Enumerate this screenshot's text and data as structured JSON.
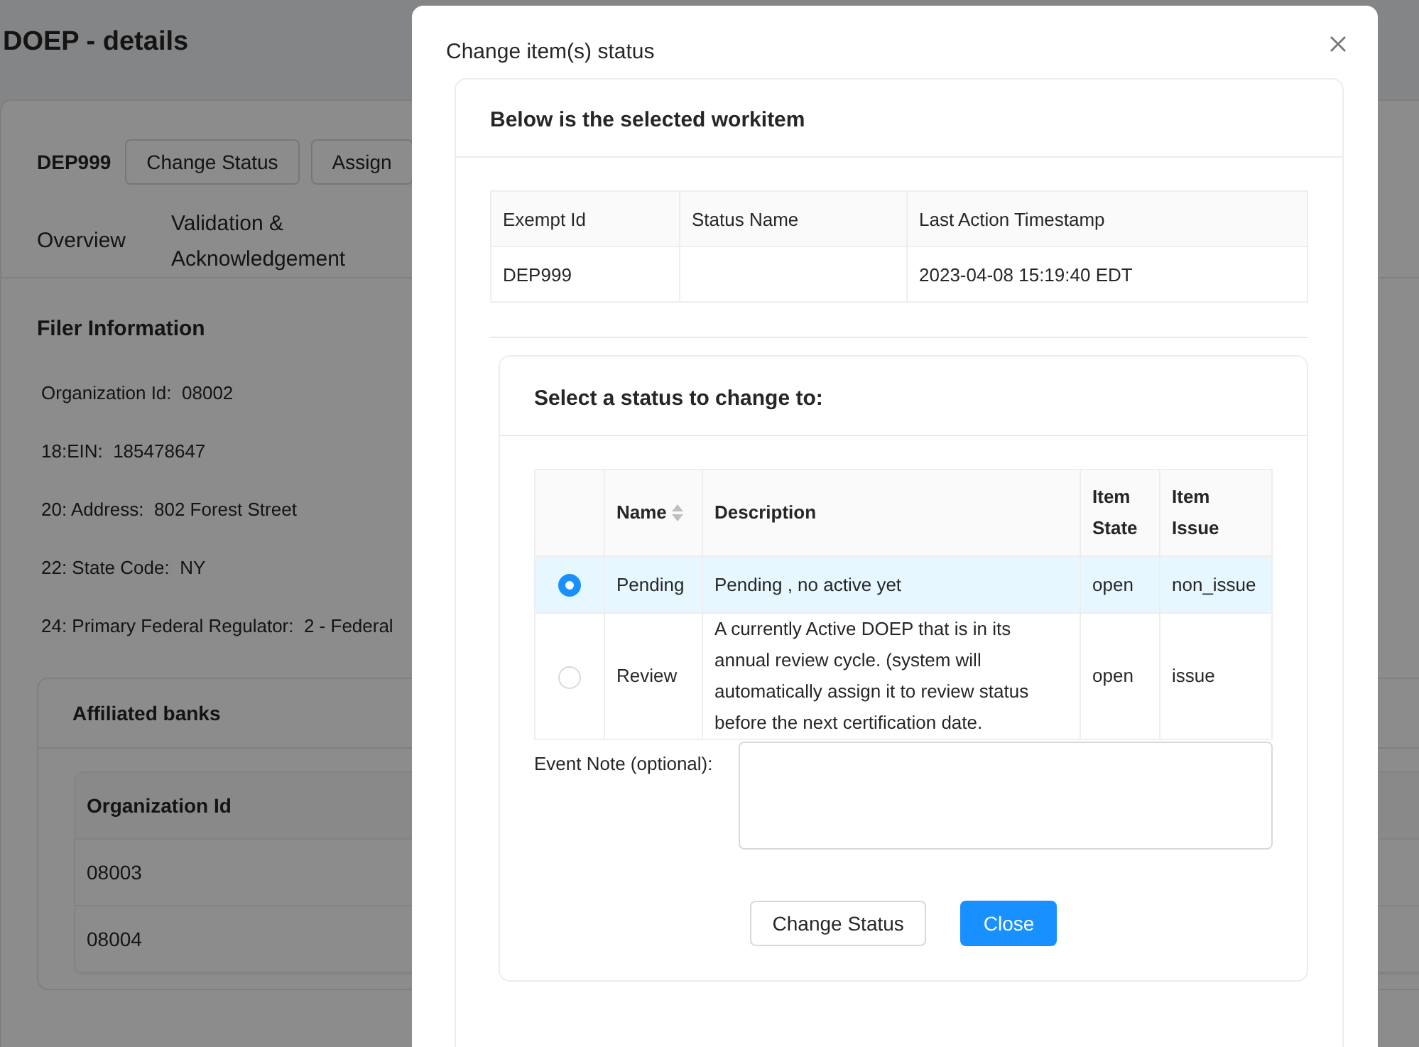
{
  "page": {
    "title": "DOEP - details",
    "record_id": "DEP999",
    "actions": [
      "Change Status",
      "Assign"
    ],
    "tabs": [
      {
        "label": "Overview"
      },
      {
        "label": "Validation & Acknowledgement"
      }
    ],
    "section_title": "Filer Information",
    "fields": [
      {
        "label": "Organization Id:",
        "value": "08002"
      },
      {
        "label": "18:EIN:",
        "value": "185478647"
      },
      {
        "label": "20: Address:",
        "value": "802 Forest Street"
      },
      {
        "label": "22: State Code:",
        "value": "NY"
      },
      {
        "label": "24: Primary Federal Regulator:",
        "value": "2 - Federal"
      }
    ],
    "affiliated": {
      "title": "Affiliated banks",
      "column": "Organization Id",
      "rows": [
        "08003",
        "08004"
      ]
    }
  },
  "modal": {
    "title": "Change item(s) status",
    "workitem_title": "Below is the selected workitem",
    "workitem_columns": [
      "Exempt Id",
      "Status Name",
      "Last Action Timestamp"
    ],
    "workitem_row": {
      "exempt_id": "DEP999",
      "last_action_timestamp": "2023-04-08 15:19:40 EDT"
    },
    "status_title": "Select a status to change to:",
    "status_columns": [
      "Name",
      "Description",
      "Item State",
      "Item Issue"
    ],
    "statuses": [
      {
        "name": "Pending",
        "description": "Pending , no active yet",
        "state": "open",
        "issue": "non_issue",
        "selected": true
      },
      {
        "name": "Review",
        "description": "A currently Active DOEP that is in its annual review cycle. (system will automatically assign it to review status before the next certification date.",
        "state": "open",
        "issue": "issue",
        "selected": false
      }
    ],
    "note_label": "Event Note (optional):",
    "buttons": [
      {
        "label": "Change Status",
        "kind": "default"
      },
      {
        "label": "Close",
        "kind": "primary"
      }
    ]
  }
}
